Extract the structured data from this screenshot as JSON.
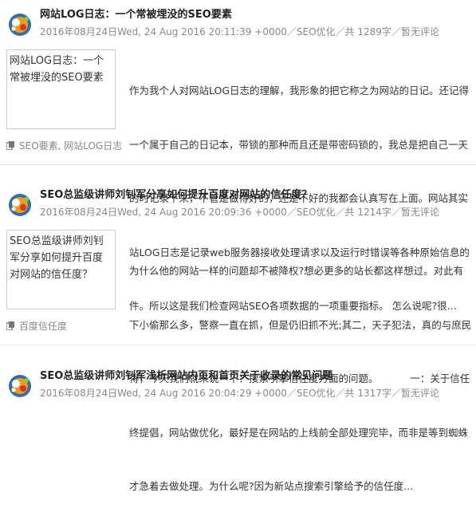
{
  "posts": [
    {
      "title": "网站LOG日志：一个常被埋没的SEO要素",
      "meta": {
        "date": "2016年08月24日Wed, 24 Aug 2016 20:11:39 +0000",
        "sep1": "／",
        "category": "SEO优化",
        "sep2": "／共 ",
        "words": "1289字",
        "sep3": "／",
        "comments": "暂无评论"
      },
      "thumb": "网站LOG日志：一个常被埋没的SEO要素",
      "excerpt": [
        "作为我个人对网站LOG日志的理解，我形象的把它称之为网站的日记。还记得",
        "一个属于自己的日记本，带锁的那种而且还是带密码锁的，我总是把自己一天",
        "的时记录下来，不管是做得好的，还是不好的我都会认真写在上面。网站其实",
        "站LOG日志是记录web服务器接收处理请求以及运行时错误等各种原始信息的",
        "件。所以这是我们检查网站SEO各项数据的一项重要指标。 怎么说呢?很..."
      ],
      "tags": "SEO要素, 网站LOG日志"
    },
    {
      "title": "SEO总监级讲师刘钊军分享如何提升百度对网站的信任度？",
      "meta": {
        "date": "2016年08月24日Wed, 24 Aug 2016 20:09:36 +0000",
        "sep1": "／",
        "category": "SEO优化",
        "sep2": "／共 ",
        "words": "1214字",
        "sep3": "／",
        "comments": "暂无评论"
      },
      "thumb": "SEO总监级讲师刘钊军分享如何提升百度对网站的信任度？",
      "excerpt": [
        "为什么他的网站一样的问题却不被降权?想必更多的站长都这样想过。对此有",
        "下小偷那么多，警察一直在抓，但是仍旧抓不光;其二，天子犯法，真的与庶民",
        "得，今天我们就来说一下：搜索引擎信任度方面的问题。          一：关于信任",
        "终提倡，网站做优化，最好是在网站的上线前全部处理完毕，而非是等到蜘蛛",
        "才急着去做处理。为什么呢?因为新站点搜索引擎给予的信任度..."
      ],
      "tags": "百度信任度"
    },
    {
      "title": "SEO总监级讲师刘钊军浅析网站内页和首页关于收录的常见问题",
      "meta": {
        "date": "2016年08月24日Wed, 24 Aug 2016 20:04:29 +0000",
        "sep1": "／",
        "category": "SEO优化",
        "sep2": "／共 ",
        "words": "1317字",
        "sep3": "／",
        "comments": "暂无评论"
      },
      "thumb": "",
      "excerpt": [],
      "tags": ""
    }
  ],
  "colors": {
    "title": "#222222",
    "meta": "#888888",
    "divider": "#e6e6e6",
    "logo_blue": "#2f6db5",
    "logo_orange": "#f39c12",
    "logo_red": "#d9342b"
  },
  "icons": {
    "author_logo": "colorful-dots-logo-icon",
    "tags": "tag-icon"
  }
}
